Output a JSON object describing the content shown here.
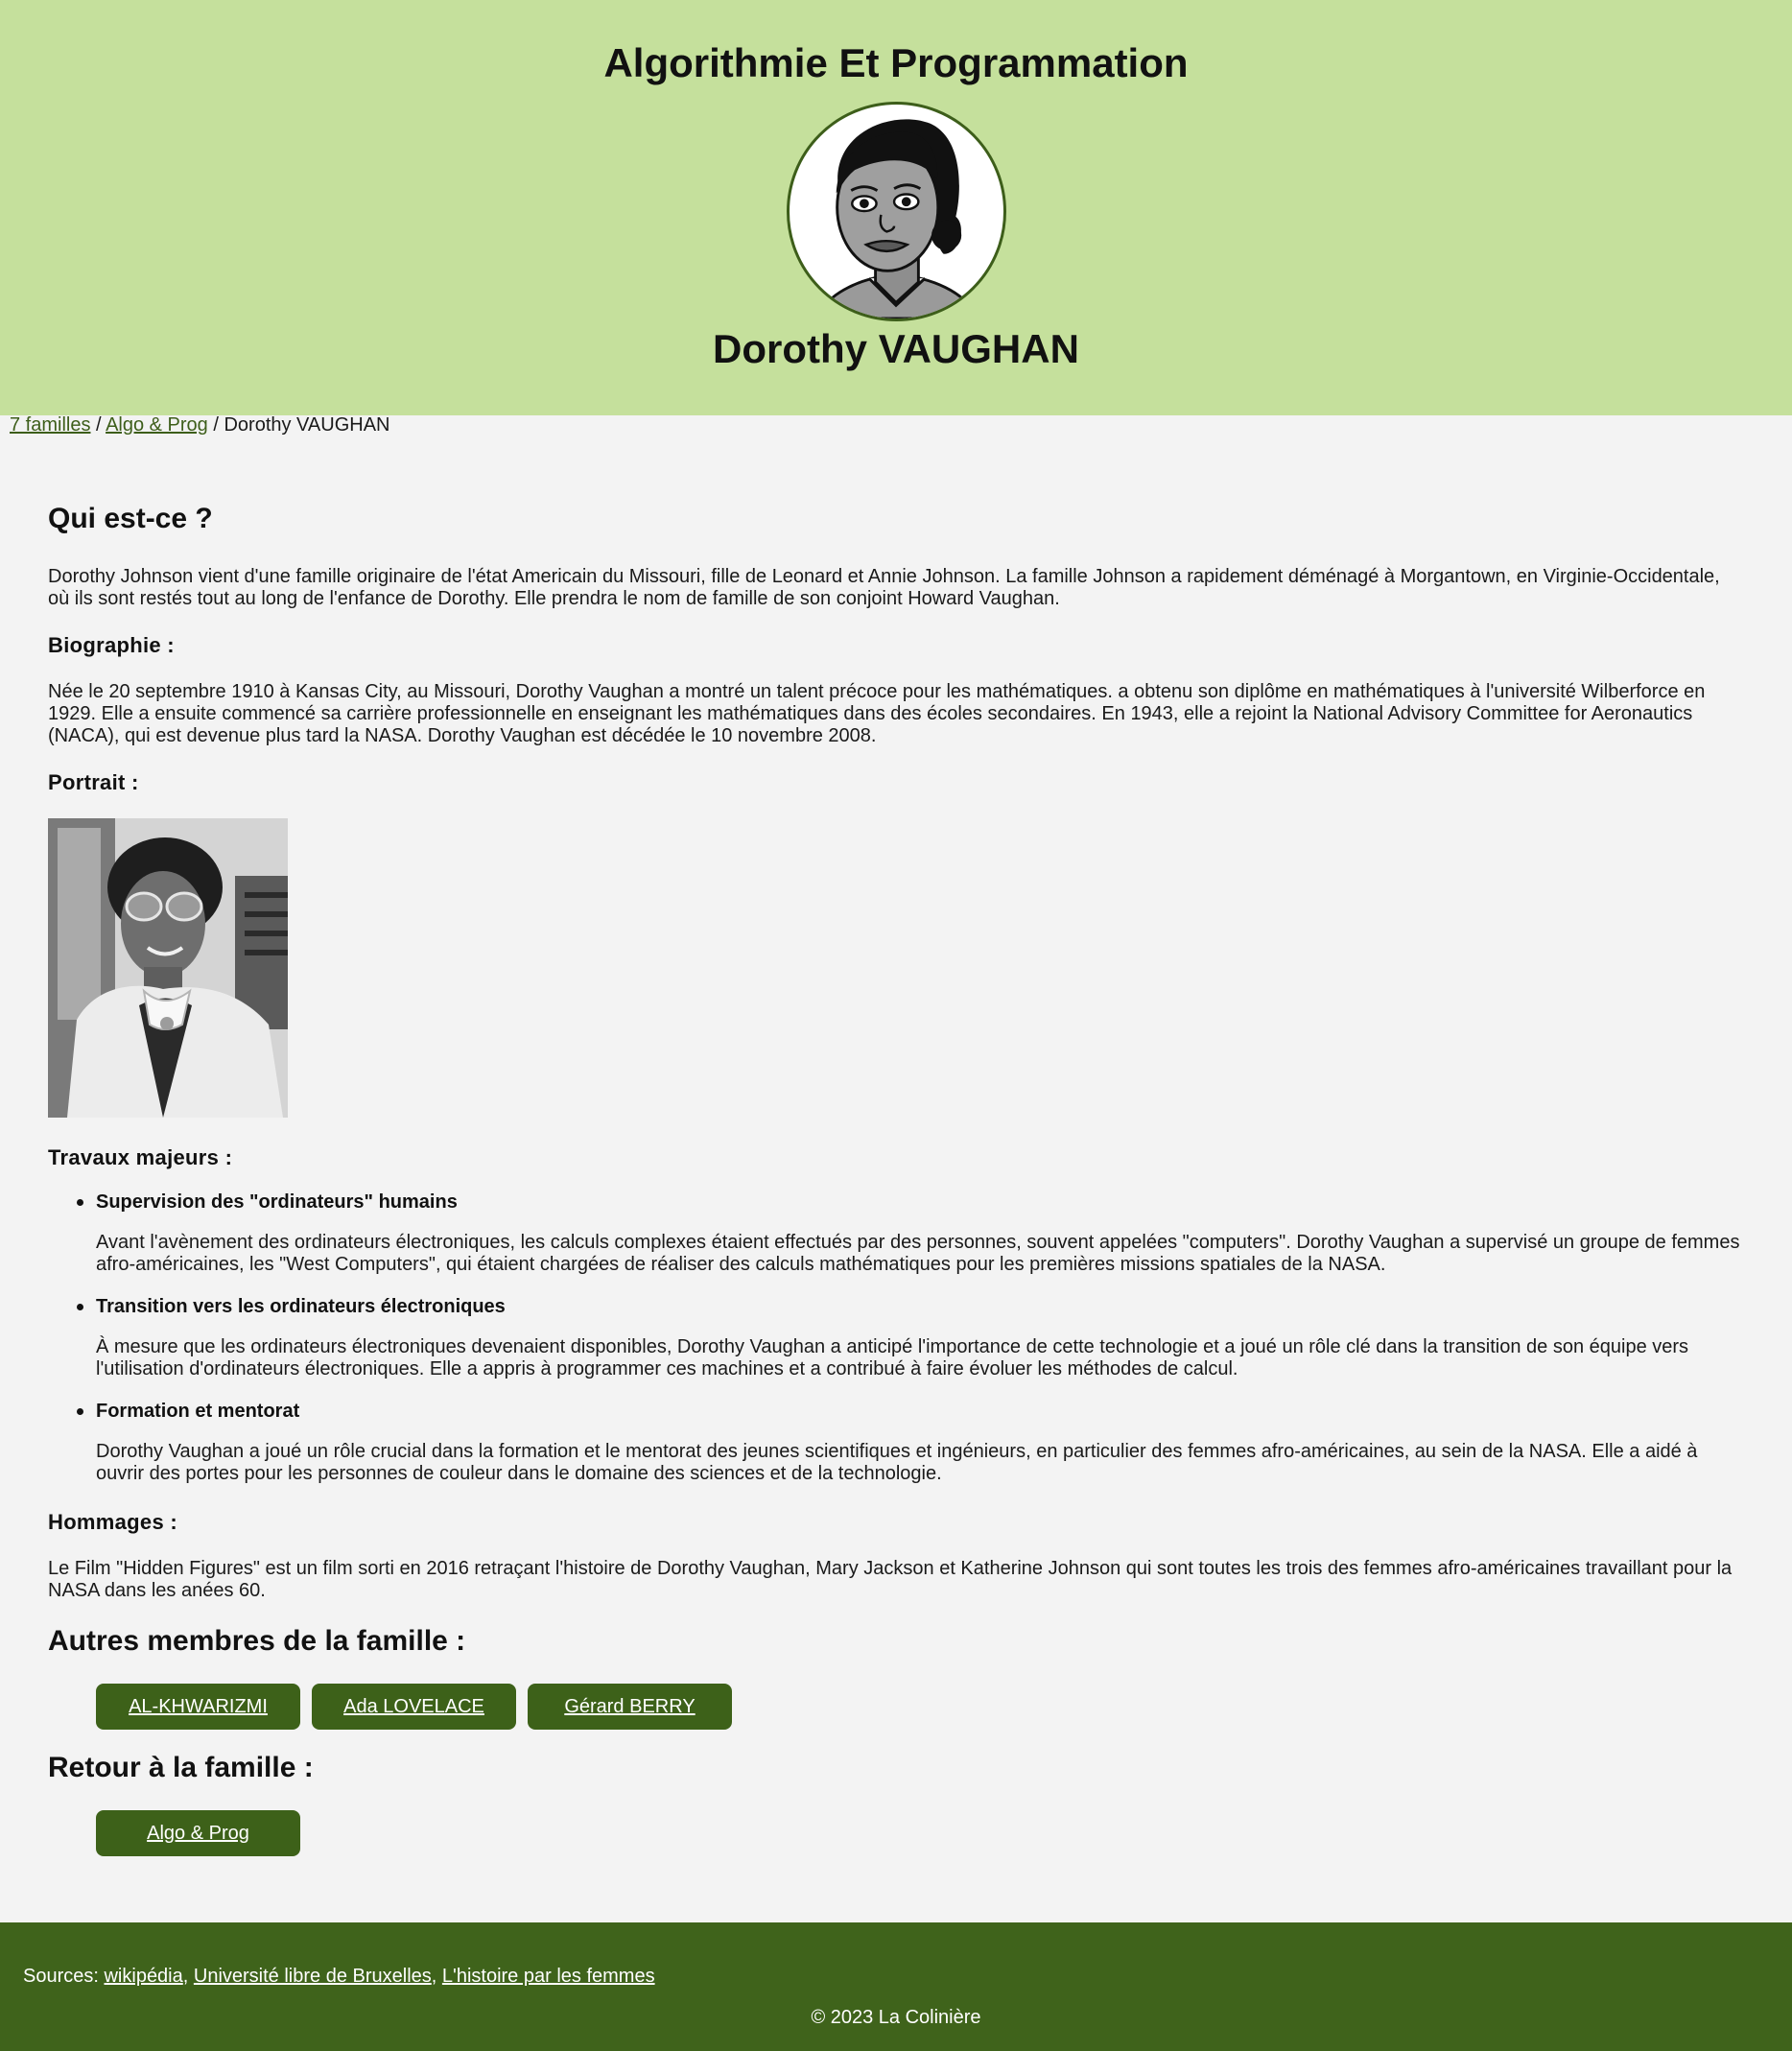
{
  "header": {
    "title": "Algorithmie Et Programmation",
    "person_name": "Dorothy VAUGHAN",
    "avatar_icon": "cartoon-portrait-avatar"
  },
  "breadcrumb": {
    "link1": "7 familles",
    "sep1": " / ",
    "link2": "Algo & Prog",
    "sep2": " / ",
    "current": "Dorothy VAUGHAN"
  },
  "main": {
    "who_heading": "Qui est-ce ?",
    "who_text": "Dorothy Johnson vient d'une famille originaire de l'état Americain du Missouri, fille de Leonard et Annie Johnson. La famille Johnson a rapidement déménagé à Morgantown, en Virginie-Occidentale, où ils sont restés tout au long de l'enfance de Dorothy. Elle prendra le nom de famille de son conjoint Howard Vaughan.",
    "bio_heading": "Biographie :",
    "bio_text": "Née le 20 septembre 1910 à Kansas City, au Missouri, Dorothy Vaughan a montré un talent précoce pour les mathématiques. a obtenu son diplôme en mathématiques à l'université Wilberforce en 1929. Elle a ensuite commencé sa carrière professionnelle en enseignant les mathématiques dans des écoles secondaires. En 1943, elle a rejoint la National Advisory Committee for Aeronautics (NACA), qui est devenue plus tard la NASA. Dorothy Vaughan est décédée le 10 novembre 2008.",
    "portrait_heading": "Portrait :",
    "works_heading": "Travaux majeurs :",
    "works": [
      {
        "title": "Supervision des \"ordinateurs\" humains",
        "desc": "Avant l'avènement des ordinateurs électroniques, les calculs complexes étaient effectués par des personnes, souvent appelées \"computers\". Dorothy Vaughan a supervisé un groupe de femmes afro-américaines, les \"West Computers\", qui étaient chargées de réaliser des calculs mathématiques pour les premières missions spatiales de la NASA."
      },
      {
        "title": "Transition vers les ordinateurs électroniques",
        "desc": "À mesure que les ordinateurs électroniques devenaient disponibles, Dorothy Vaughan a anticipé l'importance de cette technologie et a joué un rôle clé dans la transition de son équipe vers l'utilisation d'ordinateurs électroniques. Elle a appris à programmer ces machines et a contribué à faire évoluer les méthodes de calcul."
      },
      {
        "title": "Formation et mentorat",
        "desc": "Dorothy Vaughan a joué un rôle crucial dans la formation et le mentorat des jeunes scientifiques et ingénieurs, en particulier des femmes afro-américaines, au sein de la NASA. Elle a aidé à ouvrir des portes pour les personnes de couleur dans le domaine des sciences et de la technologie."
      }
    ],
    "tributes_heading": "Hommages :",
    "tributes_text": "Le Film \"Hidden Figures\" est un film sorti en 2016 retraçant l'histoire de Dorothy Vaughan, Mary Jackson et Katherine Johnson qui sont toutes les trois des femmes afro-américaines travaillant pour la NASA dans les anées 60.",
    "others_heading": "Autres membres de la famille :",
    "others": [
      "AL-KHWARIZMI",
      "Ada LOVELACE",
      "Gérard BERRY"
    ],
    "back_heading": "Retour à la famille :",
    "back_button": "Algo & Prog"
  },
  "footer": {
    "sources_label": "Sources: ",
    "source1": "wikipédia",
    "comma1": ", ",
    "source2": "Université libre de Bruxelles",
    "comma2": ", ",
    "source3": "L'histoire par les femmes",
    "copyright": "© 2023 La Colinière"
  },
  "colors": {
    "header_bg": "#c5e09c",
    "accent_dark": "#3d6119",
    "footer_bg": "#3f631b",
    "page_bg": "#f3f3f3"
  }
}
